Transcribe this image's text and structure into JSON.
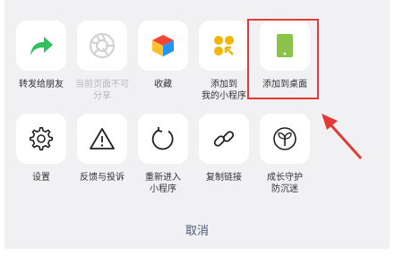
{
  "share_sheet": {
    "row1": [
      {
        "label": "转发给朋友",
        "icon": "forward-arrow-icon",
        "disabled": false
      },
      {
        "label": "当前页面不可\n分享",
        "icon": "aperture-icon",
        "disabled": true
      },
      {
        "label": "收藏",
        "icon": "favorite-cube-icon",
        "disabled": false
      },
      {
        "label": "添加到\n我的小程序",
        "icon": "mini-program-add-icon",
        "disabled": false
      },
      {
        "label": "添加到桌面",
        "icon": "phone-desktop-icon",
        "disabled": false
      }
    ],
    "row2": [
      {
        "label": "设置",
        "icon": "gear-icon",
        "disabled": false
      },
      {
        "label": "反馈与投诉",
        "icon": "warning-icon",
        "disabled": false
      },
      {
        "label": "重新进入\n小程序",
        "icon": "reload-icon",
        "disabled": false
      },
      {
        "label": "复制链接",
        "icon": "link-icon",
        "disabled": false
      },
      {
        "label": "成长守护\n防沉迷",
        "icon": "sprout-icon",
        "disabled": false
      }
    ],
    "cancel_label": "取消"
  },
  "colors": {
    "accent_green": "#2dc25e",
    "desktop_green": "#8bc34a",
    "annotation_red": "#e53935",
    "cancel_text": "#4a5a78"
  }
}
